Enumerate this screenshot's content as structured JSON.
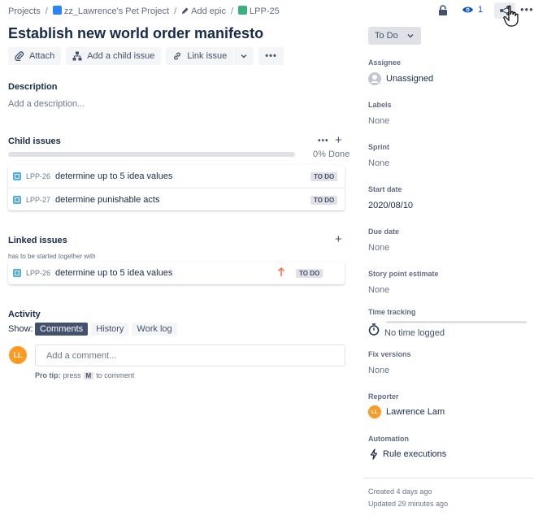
{
  "breadcrumbs": {
    "projects": "Projects",
    "project": "zz_Lawrence's Pet Project",
    "add_epic": "Add epic",
    "issue_key": "LPP-25"
  },
  "header": {
    "watch_count": "1"
  },
  "issue": {
    "title": "Establish new world order manifesto"
  },
  "toolbar": {
    "attach": "Attach",
    "add_child": "Add a child issue",
    "link_issue": "Link issue"
  },
  "description": {
    "heading": "Description",
    "placeholder": "Add a description..."
  },
  "child_issues": {
    "heading": "Child issues",
    "progress_label": "0% Done",
    "progress": 0,
    "items": [
      {
        "key": "LPP-26",
        "summary": "determine up to 5 idea values",
        "status": "TO DO"
      },
      {
        "key": "LPP-27",
        "summary": "determine punishable acts",
        "status": "TO DO"
      }
    ]
  },
  "linked_issues": {
    "heading": "Linked issues",
    "relation": "has to be started together with",
    "items": [
      {
        "key": "LPP-26",
        "summary": "determine up to 5 idea values",
        "status": "TO DO"
      }
    ]
  },
  "activity": {
    "heading": "Activity",
    "show_label": "Show:",
    "tabs": [
      "Comments",
      "History",
      "Work log"
    ],
    "avatar_initials": "LL",
    "comment_placeholder": "Add a comment...",
    "protip_prefix": "Pro tip:",
    "protip_press": "press",
    "protip_key": "M",
    "protip_suffix": "to comment"
  },
  "sidebar": {
    "status": "To Do",
    "assignee_label": "Assignee",
    "assignee": "Unassigned",
    "labels_label": "Labels",
    "labels": "None",
    "sprint_label": "Sprint",
    "sprint": "None",
    "start_date_label": "Start date",
    "start_date": "2020/08/10",
    "due_date_label": "Due date",
    "due_date": "None",
    "story_points_label": "Story point estimate",
    "story_points": "None",
    "time_tracking_label": "Time tracking",
    "time_tracking": "No time logged",
    "fix_versions_label": "Fix versions",
    "fix_versions": "None",
    "reporter_label": "Reporter",
    "reporter": "Lawrence Lam",
    "reporter_initials": "LL",
    "automation_label": "Automation",
    "automation": "Rule executions",
    "created": "Created 4 days ago",
    "updated": "Updated 29 minutes ago"
  },
  "colors": {
    "accent": "#0052cc",
    "priority_high": "#ff7452",
    "avatar": "#ff991f",
    "epic_green": "#36b37e"
  }
}
